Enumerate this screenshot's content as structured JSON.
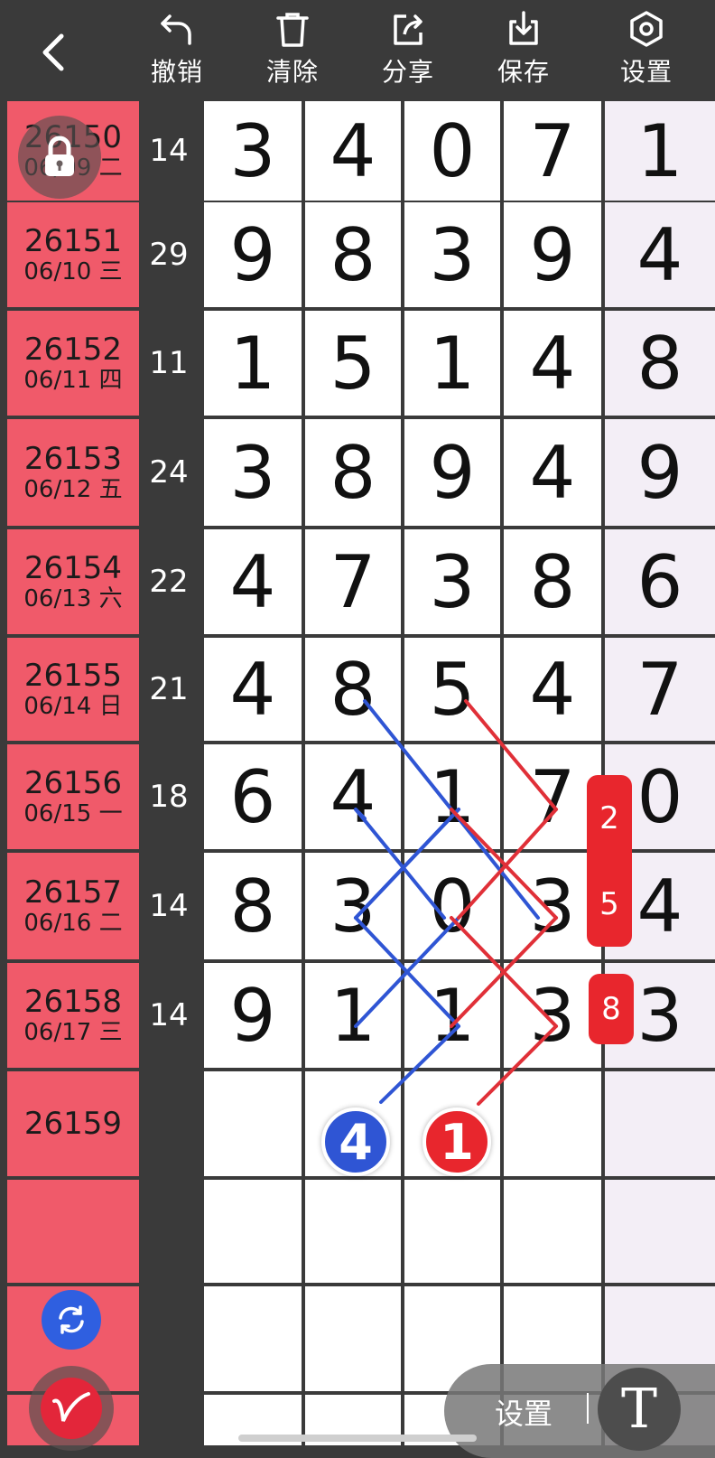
{
  "toolbar": {
    "undo": "撤销",
    "clear": "清除",
    "share": "分享",
    "save": "保存",
    "settings": "设置"
  },
  "rows": [
    {
      "issue": "26150",
      "date": "06/09 二",
      "sum": "14",
      "digits": [
        "3",
        "4",
        "0",
        "7"
      ],
      "last": "1"
    },
    {
      "issue": "26151",
      "date": "06/10 三",
      "sum": "29",
      "digits": [
        "9",
        "8",
        "3",
        "9"
      ],
      "last": "4"
    },
    {
      "issue": "26152",
      "date": "06/11 四",
      "sum": "11",
      "digits": [
        "1",
        "5",
        "1",
        "4"
      ],
      "last": "8"
    },
    {
      "issue": "26153",
      "date": "06/12 五",
      "sum": "24",
      "digits": [
        "3",
        "8",
        "9",
        "4"
      ],
      "last": "9"
    },
    {
      "issue": "26154",
      "date": "06/13 六",
      "sum": "22",
      "digits": [
        "4",
        "7",
        "3",
        "8"
      ],
      "last": "6"
    },
    {
      "issue": "26155",
      "date": "06/14 日",
      "sum": "21",
      "digits": [
        "4",
        "8",
        "5",
        "4"
      ],
      "last": "7"
    },
    {
      "issue": "26156",
      "date": "06/15 一",
      "sum": "18",
      "digits": [
        "6",
        "4",
        "1",
        "7"
      ],
      "last": "0"
    },
    {
      "issue": "26157",
      "date": "06/16 二",
      "sum": "14",
      "digits": [
        "8",
        "3",
        "0",
        "3"
      ],
      "last": "4"
    },
    {
      "issue": "26158",
      "date": "06/17 三",
      "sum": "14",
      "digits": [
        "9",
        "1",
        "1",
        "3"
      ],
      "last": "3"
    },
    {
      "issue": "26159",
      "date": "",
      "sum": "",
      "digits": [
        "",
        "",
        "",
        ""
      ],
      "last": ""
    },
    {
      "issue": "",
      "date": "",
      "sum": "",
      "digits": [
        "",
        "",
        "",
        ""
      ],
      "last": ""
    },
    {
      "issue": "",
      "date": "",
      "sum": "",
      "digits": [
        "",
        "",
        "",
        ""
      ],
      "last": ""
    },
    {
      "issue": "",
      "date": "",
      "sum": "",
      "digits": [
        "",
        "",
        "",
        ""
      ],
      "last": ""
    }
  ],
  "markers": {
    "badge_top": [
      "2",
      "5"
    ],
    "badge_bottom": "8",
    "ball_blue": "4",
    "ball_red": "1"
  },
  "bottom_bar": {
    "settings_label": "设置",
    "text_tool": "T"
  },
  "colors": {
    "accent_red": "#e8262d",
    "accent_blue": "#2f55d4",
    "date_cell": "#f05a6a",
    "dark_bg": "#3a3a3a"
  }
}
